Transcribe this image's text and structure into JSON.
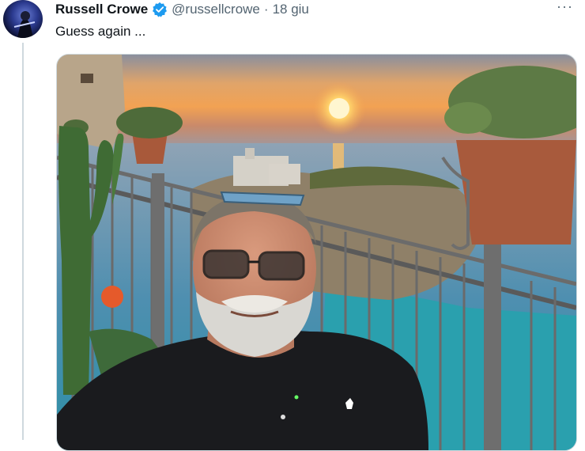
{
  "tweet": {
    "author_name": "Russell Crowe",
    "handle": "@russellcrowe",
    "separator": "·",
    "date": "18 giu",
    "text": "Guess again ...",
    "more_label": "···"
  },
  "colors": {
    "verified": "#1d9bf0",
    "secondary_text": "#536471",
    "thread_line": "#cfd9de"
  },
  "icons": {
    "verified": "verified-badge-icon",
    "more": "more-options-icon"
  }
}
